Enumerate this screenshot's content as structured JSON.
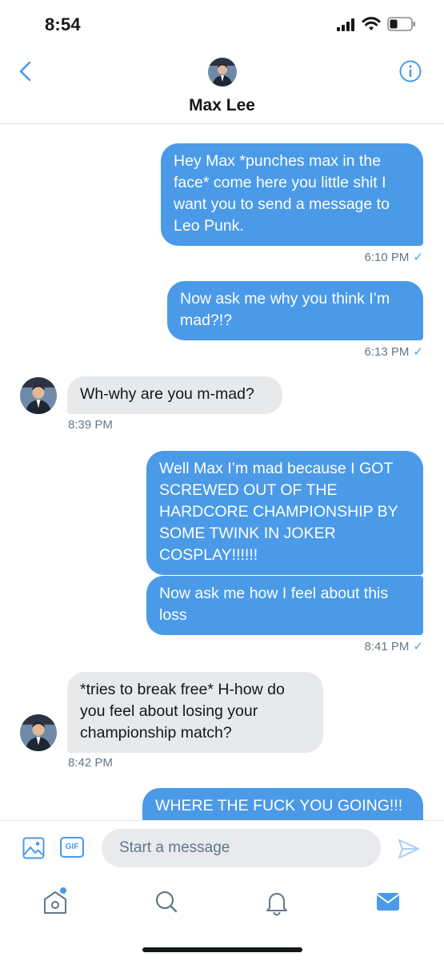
{
  "status_bar": {
    "time": "8:54"
  },
  "header": {
    "contact_name": "Max Lee"
  },
  "messages": [
    {
      "direction": "outgoing",
      "text": "Hey Max *punches max in the face* come here you little shit I want you to send a message to Leo Punk.",
      "time": "6:10 PM"
    },
    {
      "direction": "outgoing",
      "text": "Now ask me why you think I’m mad?!?",
      "time": "6:13 PM"
    },
    {
      "direction": "incoming",
      "text": "Wh-why are you m-mad?",
      "time": "8:39 PM"
    },
    {
      "direction": "outgoing",
      "text": "Well Max I’m mad because I GOT SCREWED OUT OF THE HARDCORE CHAMPIONSHIP BY SOME TWINK IN JOKER COSPLAY!!!!!!"
    },
    {
      "direction": "outgoing",
      "text": "Now ask me how I feel about this loss",
      "time": "8:41 PM"
    },
    {
      "direction": "incoming",
      "text": "*tries to break free* H-how do you feel about losing your championship match?",
      "time": "8:42 PM"
    },
    {
      "direction": "outgoing",
      "text": "WHERE THE FUCK YOU GOING!!!"
    }
  ],
  "composer": {
    "placeholder": "Start a message",
    "gif_label": "GIF"
  },
  "tabs": [
    {
      "name": "home",
      "icon": "home-icon",
      "has_notification_dot": true
    },
    {
      "name": "search",
      "icon": "search-icon"
    },
    {
      "name": "notifications",
      "icon": "bell-icon"
    },
    {
      "name": "messages",
      "icon": "mail-icon",
      "active": true
    }
  ],
  "colors": {
    "accent": "#4a9ae8",
    "incoming_bubble": "#e7e9eb",
    "secondary_text": "#657786"
  }
}
